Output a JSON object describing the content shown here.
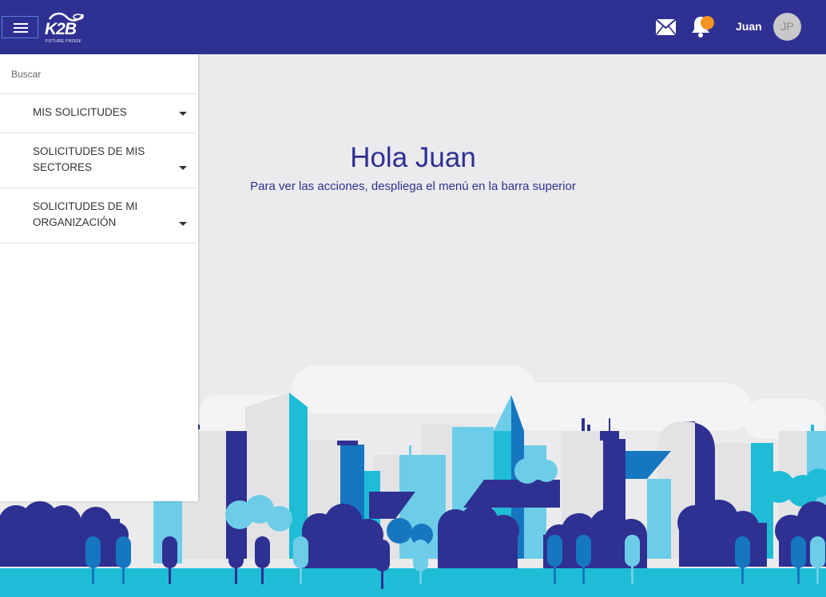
{
  "header": {
    "logo_text": "K2B",
    "logo_tagline": "FUTURE PROOF",
    "user_name": "Juan",
    "avatar_initials": "JP",
    "colors": {
      "bar": "#2e3192",
      "badge": "#f7931e"
    }
  },
  "sidebar": {
    "search_placeholder": "Buscar",
    "items": [
      {
        "label": "MIS SOLICITUDES"
      },
      {
        "label": "SOLICITUDES DE MIS SECTORES"
      },
      {
        "label": "SOLICITUDES DE MI ORGANIZACIÓN"
      }
    ]
  },
  "main": {
    "greeting": "Hola Juan",
    "subtitle": "Para ver las acciones, despliega el menú en la barra superior"
  }
}
